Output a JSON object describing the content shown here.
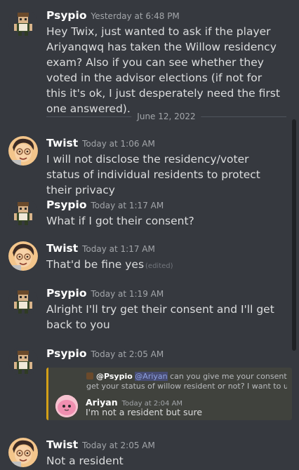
{
  "messages": [
    {
      "author": "Psypio",
      "timestamp": "Yesterday at 6:48 PM",
      "text": "Hey Twix, just wanted to ask if the player Ariyanqwq has taken the Willow residency exam? Also if you can see whether they voted in the advisor elections (if not for this it's ok, I just desperately need the first one answered)."
    },
    {
      "author": "Twist",
      "timestamp": "Today at 1:06 AM",
      "text": "I will not disclose the residency/voter status of individual residents to protect their privacy"
    },
    {
      "author": "Psypio",
      "timestamp": "Today at 1:17 AM",
      "text": "What if I got their consent?"
    },
    {
      "author": "Twist",
      "timestamp": "Today at 1:17 AM",
      "text": "That'd be fine yes",
      "edited": "(edited)"
    },
    {
      "author": "Psypio",
      "timestamp": "Today at 1:19 AM",
      "text": "Alright I'll try get their consent and I'll get back to you"
    },
    {
      "author": "Psypio",
      "timestamp": "Today at 2:05 AM",
      "text": ""
    },
    {
      "author": "Twist",
      "timestamp": "Today at 2:05 AM",
      "text": "Not a resident"
    }
  ],
  "date_divider": "June 12, 2022",
  "embed": {
    "reply_author": "@Psypio",
    "reply_mention": "@Ariyan",
    "reply_text_line1": " can you give me your consent to",
    "reply_text_line2": "get your status of willow resident or not? I want to use i...",
    "author": "Ariyan",
    "timestamp": "Today at 2:04 AM",
    "text": "I'm not a resident but sure",
    "accent_color": "#d4a017"
  },
  "colors": {
    "background": "#36393f",
    "name": "#ffffff",
    "timestamp": "#a3a6aa",
    "text": "#dcddde",
    "mention": "#8ea1e1"
  },
  "icons": {
    "psypio_avatar": "pixel-character-avatar",
    "twist_avatar": "cartoon-face-avatar",
    "ariyan_avatar": "pink-blob-avatar"
  }
}
